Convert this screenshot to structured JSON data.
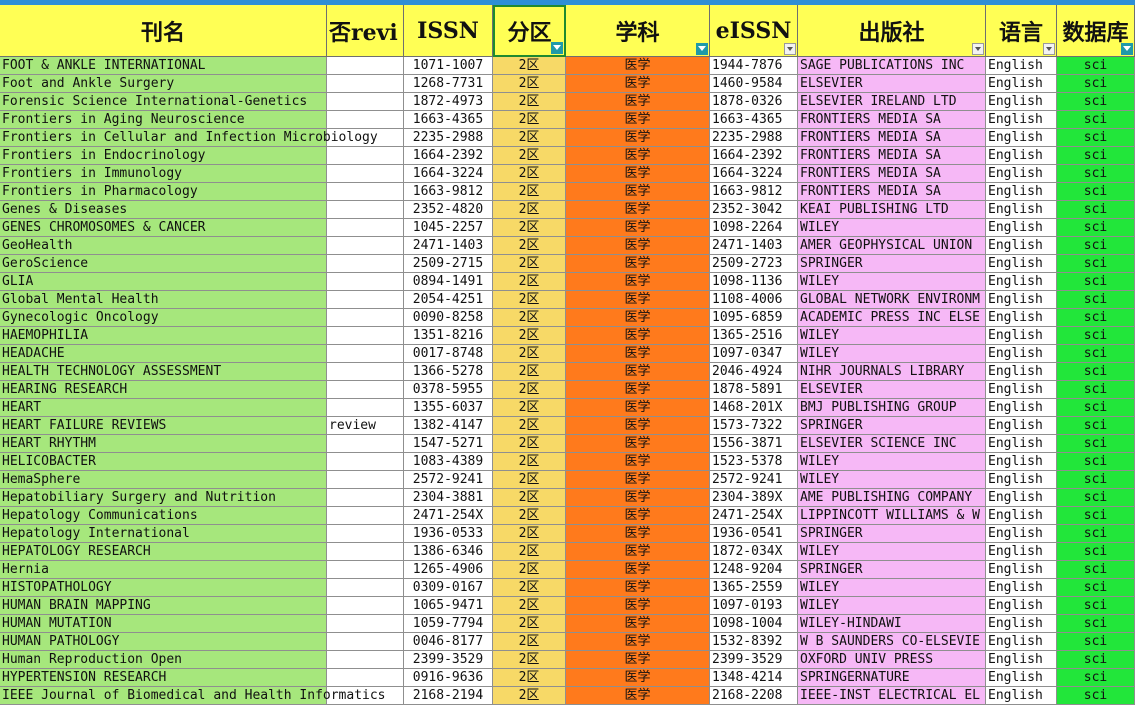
{
  "sheet": {
    "headers": [
      "刊名",
      "否revi",
      "ISSN",
      "分区",
      "学科",
      "eISSN",
      "出版社",
      "语言",
      "数据库"
    ],
    "rows": [
      [
        "FOOT & ANKLE INTERNATIONAL",
        "",
        "1071-1007",
        "2区",
        "医学",
        "1944-7876",
        "SAGE PUBLICATIONS INC",
        "English",
        "sci"
      ],
      [
        "Foot and Ankle Surgery",
        "",
        "1268-7731",
        "2区",
        "医学",
        "1460-9584",
        "ELSEVIER",
        "English",
        "sci"
      ],
      [
        "Forensic Science International-Genetics",
        "",
        "1872-4973",
        "2区",
        "医学",
        "1878-0326",
        "ELSEVIER IRELAND LTD",
        "English",
        "sci"
      ],
      [
        "Frontiers in Aging Neuroscience",
        "",
        "1663-4365",
        "2区",
        "医学",
        "1663-4365",
        "FRONTIERS MEDIA SA",
        "English",
        "sci"
      ],
      [
        "Frontiers in Cellular and Infection Microbiology",
        "",
        "2235-2988",
        "2区",
        "医学",
        "2235-2988",
        "FRONTIERS MEDIA SA",
        "English",
        "sci"
      ],
      [
        "Frontiers in Endocrinology",
        "",
        "1664-2392",
        "2区",
        "医学",
        "1664-2392",
        "FRONTIERS MEDIA SA",
        "English",
        "sci"
      ],
      [
        "Frontiers in Immunology",
        "",
        "1664-3224",
        "2区",
        "医学",
        "1664-3224",
        "FRONTIERS MEDIA SA",
        "English",
        "sci"
      ],
      [
        "Frontiers in Pharmacology",
        "",
        "1663-9812",
        "2区",
        "医学",
        "1663-9812",
        "FRONTIERS MEDIA SA",
        "English",
        "sci"
      ],
      [
        "Genes & Diseases",
        "",
        "2352-4820",
        "2区",
        "医学",
        "2352-3042",
        "KEAI PUBLISHING LTD",
        "English",
        "sci"
      ],
      [
        "GENES CHROMOSOMES & CANCER",
        "",
        "1045-2257",
        "2区",
        "医学",
        "1098-2264",
        "WILEY",
        "English",
        "sci"
      ],
      [
        "GeoHealth",
        "",
        "2471-1403",
        "2区",
        "医学",
        "2471-1403",
        "AMER GEOPHYSICAL UNION",
        "English",
        "sci"
      ],
      [
        "GeroScience",
        "",
        "2509-2715",
        "2区",
        "医学",
        "2509-2723",
        "SPRINGER",
        "English",
        "sci"
      ],
      [
        "GLIA",
        "",
        "0894-1491",
        "2区",
        "医学",
        "1098-1136",
        "WILEY",
        "English",
        "sci"
      ],
      [
        "Global Mental Health",
        "",
        "2054-4251",
        "2区",
        "医学",
        "1108-4006",
        "GLOBAL NETWORK ENVIRONM",
        "English",
        "sci"
      ],
      [
        "Gynecologic Oncology",
        "",
        "0090-8258",
        "2区",
        "医学",
        "1095-6859",
        "ACADEMIC PRESS INC ELSE",
        "English",
        "sci"
      ],
      [
        "HAEMOPHILIA",
        "",
        "1351-8216",
        "2区",
        "医学",
        "1365-2516",
        "WILEY",
        "English",
        "sci"
      ],
      [
        "HEADACHE",
        "",
        "0017-8748",
        "2区",
        "医学",
        "1097-0347",
        "WILEY",
        "English",
        "sci"
      ],
      [
        "HEALTH TECHNOLOGY ASSESSMENT",
        "",
        "1366-5278",
        "2区",
        "医学",
        "2046-4924",
        "NIHR JOURNALS LIBRARY",
        "English",
        "sci"
      ],
      [
        "HEARING RESEARCH",
        "",
        "0378-5955",
        "2区",
        "医学",
        "1878-5891",
        "ELSEVIER",
        "English",
        "sci"
      ],
      [
        "HEART",
        "",
        "1355-6037",
        "2区",
        "医学",
        "1468-201X",
        "BMJ PUBLISHING GROUP",
        "English",
        "sci"
      ],
      [
        "HEART FAILURE REVIEWS",
        "review",
        "1382-4147",
        "2区",
        "医学",
        "1573-7322",
        "SPRINGER",
        "English",
        "sci"
      ],
      [
        "HEART RHYTHM",
        "",
        "1547-5271",
        "2区",
        "医学",
        "1556-3871",
        "ELSEVIER SCIENCE INC",
        "English",
        "sci"
      ],
      [
        "HELICOBACTER",
        "",
        "1083-4389",
        "2区",
        "医学",
        "1523-5378",
        "WILEY",
        "English",
        "sci"
      ],
      [
        "HemaSphere",
        "",
        "2572-9241",
        "2区",
        "医学",
        "2572-9241",
        "WILEY",
        "English",
        "sci"
      ],
      [
        "Hepatobiliary Surgery and Nutrition",
        "",
        "2304-3881",
        "2区",
        "医学",
        "2304-389X",
        "AME PUBLISHING COMPANY",
        "English",
        "sci"
      ],
      [
        "Hepatology Communications",
        "",
        "2471-254X",
        "2区",
        "医学",
        "2471-254X",
        "LIPPINCOTT WILLIAMS & W",
        "English",
        "sci"
      ],
      [
        "Hepatology International",
        "",
        "1936-0533",
        "2区",
        "医学",
        "1936-0541",
        "SPRINGER",
        "English",
        "sci"
      ],
      [
        "HEPATOLOGY RESEARCH",
        "",
        "1386-6346",
        "2区",
        "医学",
        "1872-034X",
        "WILEY",
        "English",
        "sci"
      ],
      [
        "Hernia",
        "",
        "1265-4906",
        "2区",
        "医学",
        "1248-9204",
        "SPRINGER",
        "English",
        "sci"
      ],
      [
        "HISTOPATHOLOGY",
        "",
        "0309-0167",
        "2区",
        "医学",
        "1365-2559",
        "WILEY",
        "English",
        "sci"
      ],
      [
        "HUMAN BRAIN MAPPING",
        "",
        "1065-9471",
        "2区",
        "医学",
        "1097-0193",
        "WILEY",
        "English",
        "sci"
      ],
      [
        "HUMAN MUTATION",
        "",
        "1059-7794",
        "2区",
        "医学",
        "1098-1004",
        "WILEY-HINDAWI",
        "English",
        "sci"
      ],
      [
        "HUMAN PATHOLOGY",
        "",
        "0046-8177",
        "2区",
        "医学",
        "1532-8392",
        "W B SAUNDERS CO-ELSEVIE",
        "English",
        "sci"
      ],
      [
        "Human Reproduction Open",
        "",
        "2399-3529",
        "2区",
        "医学",
        "2399-3529",
        "OXFORD UNIV PRESS",
        "English",
        "sci"
      ],
      [
        "HYPERTENSION RESEARCH",
        "",
        "0916-9636",
        "2区",
        "医学",
        "1348-4214",
        "SPRINGERNATURE",
        "English",
        "sci"
      ],
      [
        "IEEE Journal of Biomedical and Health Informatics",
        "",
        "2168-2194",
        "2区",
        "医学",
        "2168-2208",
        "IEEE-INST ELECTRICAL EL",
        "English",
        "sci"
      ]
    ]
  }
}
